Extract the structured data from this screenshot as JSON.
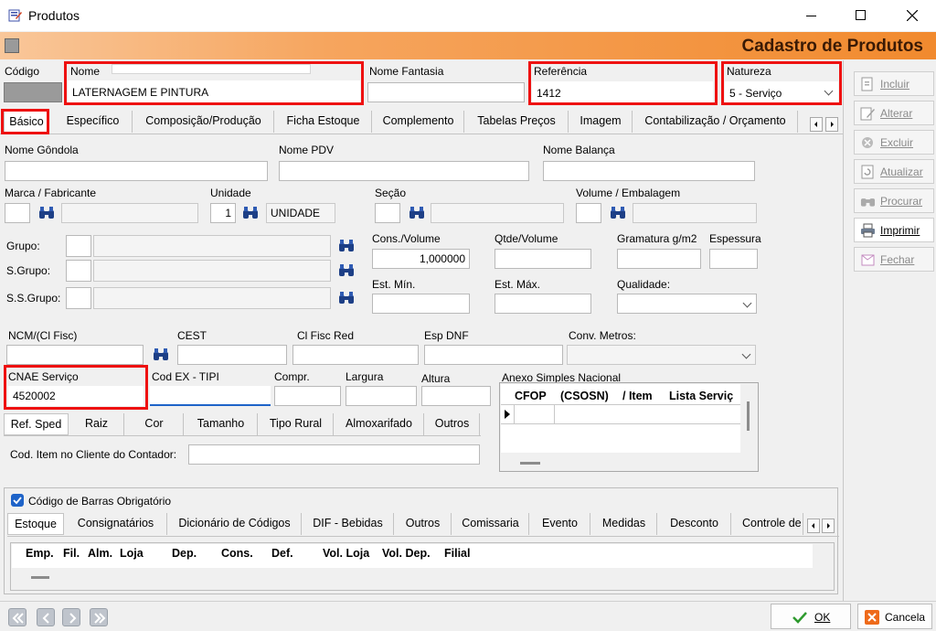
{
  "window": {
    "title": "Produtos"
  },
  "banner": {
    "title": "Cadastro de Produtos"
  },
  "top": {
    "codigo_label": "Código",
    "nome_label": "Nome",
    "nome_value": "LATERNAGEM E PINTURA",
    "fantasia_label": "Nome Fantasia",
    "referencia_label": "Referência",
    "referencia_value": "1412",
    "natureza_label": "Natureza",
    "natureza_value": "5 - Serviço"
  },
  "tabs": [
    "Básico",
    "Específico",
    "Composição/Produção",
    "Ficha Estoque",
    "Complemento",
    "Tabelas Preços",
    "Imagem",
    "Contabilização / Orçamento"
  ],
  "basico": {
    "nome_gondola": "Nome Gôndola",
    "nome_pdv": "Nome PDV",
    "nome_balanca": "Nome Balança",
    "marca": "Marca / Fabricante",
    "unidade": "Unidade",
    "unidade_code": "1",
    "unidade_desc": "UNIDADE",
    "secao": "Seção",
    "volume": "Volume / Embalagem",
    "grupo": "Grupo:",
    "sgrupo": "S.Grupo:",
    "ssgrupo": "S.S.Grupo:",
    "cons_volume": "Cons./Volume",
    "cons_volume_value": "1,000000",
    "qtde_volume": "Qtde/Volume",
    "gramatura": "Gramatura g/m2",
    "espessura": "Espessura",
    "est_min": "Est. Mín.",
    "est_max": "Est. Máx.",
    "qualidade": "Qualidade:",
    "ncm": "NCM/(Cl Fisc)",
    "cest": "CEST",
    "cl_fisc_red": "Cl Fisc Red",
    "esp_dnf": "Esp DNF",
    "conv_metros": "Conv. Metros:",
    "cnae": "CNAE Serviço",
    "cnae_value": "4520002",
    "cod_ex": "Cod EX - TIPI",
    "compr": "Compr.",
    "largura": "Largura",
    "altura": "Altura",
    "anexo": "Anexo Simples Nacional",
    "anexo_cols": [
      "CFOP",
      "(CSOSN)",
      "/ Item",
      "Lista Serviç"
    ],
    "cod_item": "Cod. Item no Cliente do Contador:"
  },
  "subtabs": [
    "Ref. Sped",
    "Raiz",
    "Cor",
    "Tamanho",
    "Tipo Rural",
    "Almoxarifado",
    "Outros"
  ],
  "barcode": {
    "label": "Código de Barras Obrigatório",
    "checked": true
  },
  "lower_tabs": [
    "Estoque",
    "Consignatários",
    "Dicionário de Códigos",
    "DIF - Bebidas",
    "Outros",
    "Comissaria",
    "Evento",
    "Medidas",
    "Desconto",
    "Controle de"
  ],
  "estoque_cols": [
    "Emp.",
    "Fil.",
    "Alm.",
    "Loja",
    "Dep.",
    "Cons.",
    "Def.",
    "Vol. Loja",
    "Vol. Dep.",
    "Filial"
  ],
  "side_buttons": [
    "Incluir",
    "Alterar",
    "Excluir",
    "Atualizar",
    "Procurar",
    "Imprimir",
    "Fechar"
  ],
  "footer": {
    "ok": "OK",
    "cancel": "Cancela"
  },
  "colors": {
    "accent_orange": "#f18a2e",
    "highlight_red": "#e11111",
    "check_blue": "#1e63c8"
  }
}
